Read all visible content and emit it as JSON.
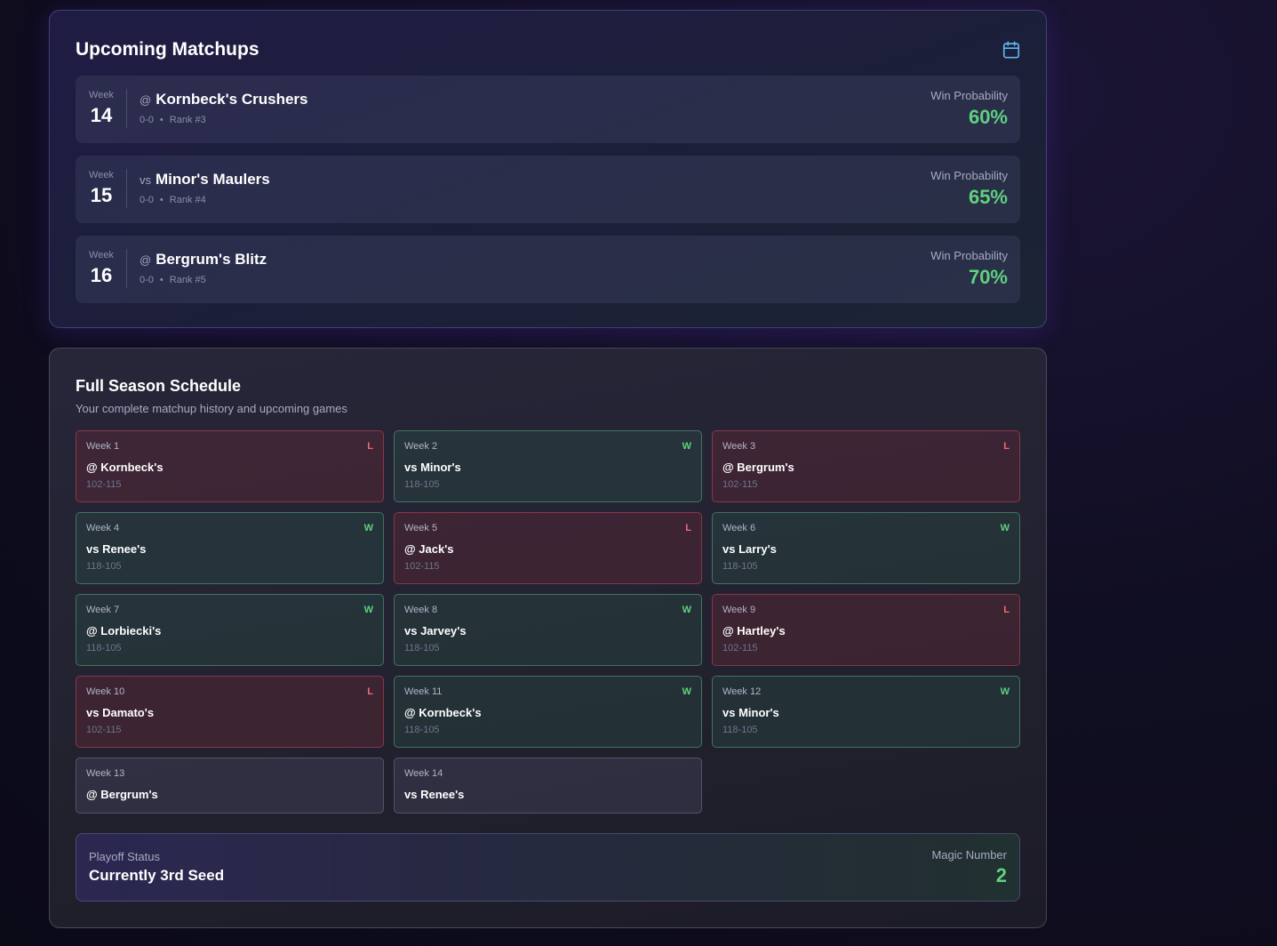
{
  "upcoming": {
    "title": "Upcoming Matchups",
    "calendar_icon": "calendar-icon",
    "matchups": [
      {
        "week_label": "Week",
        "week": "14",
        "prefix": "@",
        "opponent": "Kornbeck's Crushers",
        "record": "0-0",
        "rank": "Rank #3",
        "prob_label": "Win Probability",
        "prob": "60%"
      },
      {
        "week_label": "Week",
        "week": "15",
        "prefix": "vs",
        "opponent": "Minor's Maulers",
        "record": "0-0",
        "rank": "Rank #4",
        "prob_label": "Win Probability",
        "prob": "65%"
      },
      {
        "week_label": "Week",
        "week": "16",
        "prefix": "@",
        "opponent": "Bergrum's Blitz",
        "record": "0-0",
        "rank": "Rank #5",
        "prob_label": "Win Probability",
        "prob": "70%"
      }
    ]
  },
  "schedule": {
    "title": "Full Season Schedule",
    "subtitle": "Your complete matchup history and upcoming games",
    "games": [
      {
        "week": "Week 1",
        "result": "L",
        "opponent": "@ Kornbeck's",
        "score": "102-115"
      },
      {
        "week": "Week 2",
        "result": "W",
        "opponent": "vs Minor's",
        "score": "118-105"
      },
      {
        "week": "Week 3",
        "result": "L",
        "opponent": "@ Bergrum's",
        "score": "102-115"
      },
      {
        "week": "Week 4",
        "result": "W",
        "opponent": "vs Renee's",
        "score": "118-105"
      },
      {
        "week": "Week 5",
        "result": "L",
        "opponent": "@ Jack's",
        "score": "102-115"
      },
      {
        "week": "Week 6",
        "result": "W",
        "opponent": "vs Larry's",
        "score": "118-105"
      },
      {
        "week": "Week 7",
        "result": "W",
        "opponent": "@ Lorbiecki's",
        "score": "118-105"
      },
      {
        "week": "Week 8",
        "result": "W",
        "opponent": "vs Jarvey's",
        "score": "118-105"
      },
      {
        "week": "Week 9",
        "result": "L",
        "opponent": "@ Hartley's",
        "score": "102-115"
      },
      {
        "week": "Week 10",
        "result": "L",
        "opponent": "vs Damato's",
        "score": "102-115"
      },
      {
        "week": "Week 11",
        "result": "W",
        "opponent": "@ Kornbeck's",
        "score": "118-105"
      },
      {
        "week": "Week 12",
        "result": "W",
        "opponent": "vs Minor's",
        "score": "118-105"
      },
      {
        "week": "Week 13",
        "result": "",
        "opponent": "@ Bergrum's",
        "score": ""
      },
      {
        "week": "Week 14",
        "result": "",
        "opponent": "vs Renee's",
        "score": ""
      }
    ],
    "playoff": {
      "status_label": "Playoff Status",
      "status": "Currently 3rd Seed",
      "magic_label": "Magic Number",
      "magic_number": "2"
    }
  }
}
